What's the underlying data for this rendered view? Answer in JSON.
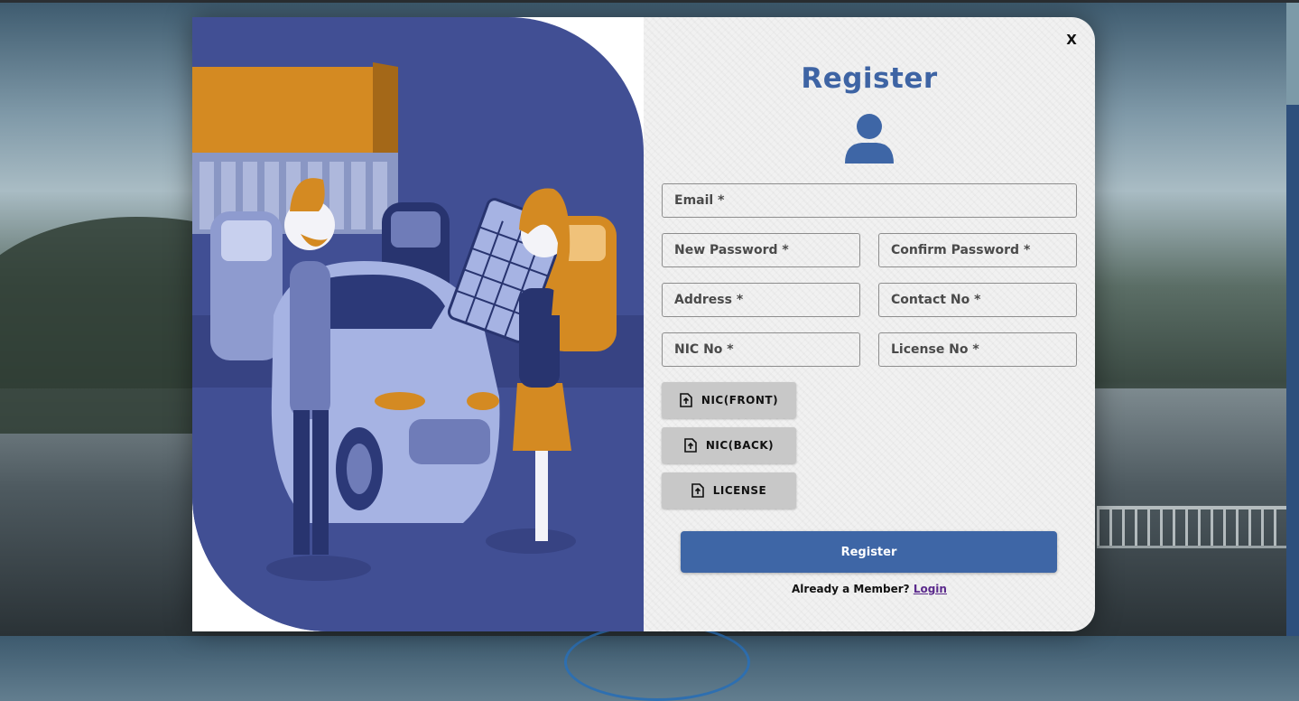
{
  "modal": {
    "close_label": "X",
    "title": "Register",
    "fields": {
      "email": "Email *",
      "new_password": "New Password *",
      "confirm_password": "Confirm Password *",
      "address": "Address *",
      "contact_no": "Contact No *",
      "nic_no": "NIC No *",
      "license_no": "License No *"
    },
    "uploads": {
      "nic_front": "NIC(FRONT)",
      "nic_back": "NIC(BACK)",
      "license": "LICENSE"
    },
    "register_button": "Register",
    "member_text": "Already a Member?",
    "login_link": "Login"
  },
  "colors": {
    "accent": "#3e66a6",
    "illustration_bg": "#414f94",
    "illustration_orange": "#d48a22"
  },
  "icons": {
    "user": "user-icon",
    "upload": "file-upload-icon",
    "close": "close-icon"
  }
}
